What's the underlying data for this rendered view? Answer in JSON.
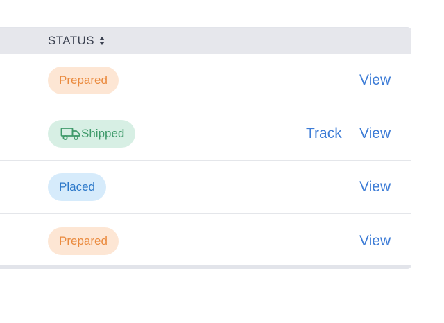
{
  "table": {
    "status_header": "STATUS",
    "rows": [
      {
        "status": "Prepared",
        "actions": {
          "view": "View"
        }
      },
      {
        "status": "Shipped",
        "actions": {
          "track": "Track",
          "view": "View"
        }
      },
      {
        "status": "Placed",
        "actions": {
          "view": "View"
        }
      },
      {
        "status": "Prepared",
        "actions": {
          "view": "View"
        }
      }
    ]
  },
  "colors": {
    "prepared_bg": "#fde6d4",
    "prepared_text": "#ea8a3e",
    "shipped_bg": "#d7efe4",
    "shipped_text": "#3f9a6a",
    "placed_bg": "#d6ebfb",
    "placed_text": "#2c78c9",
    "link": "#3d7cd6",
    "header_bg": "#e6e7ec"
  },
  "icons": {
    "sort": "sort-icon",
    "shipped": "truck-icon"
  }
}
